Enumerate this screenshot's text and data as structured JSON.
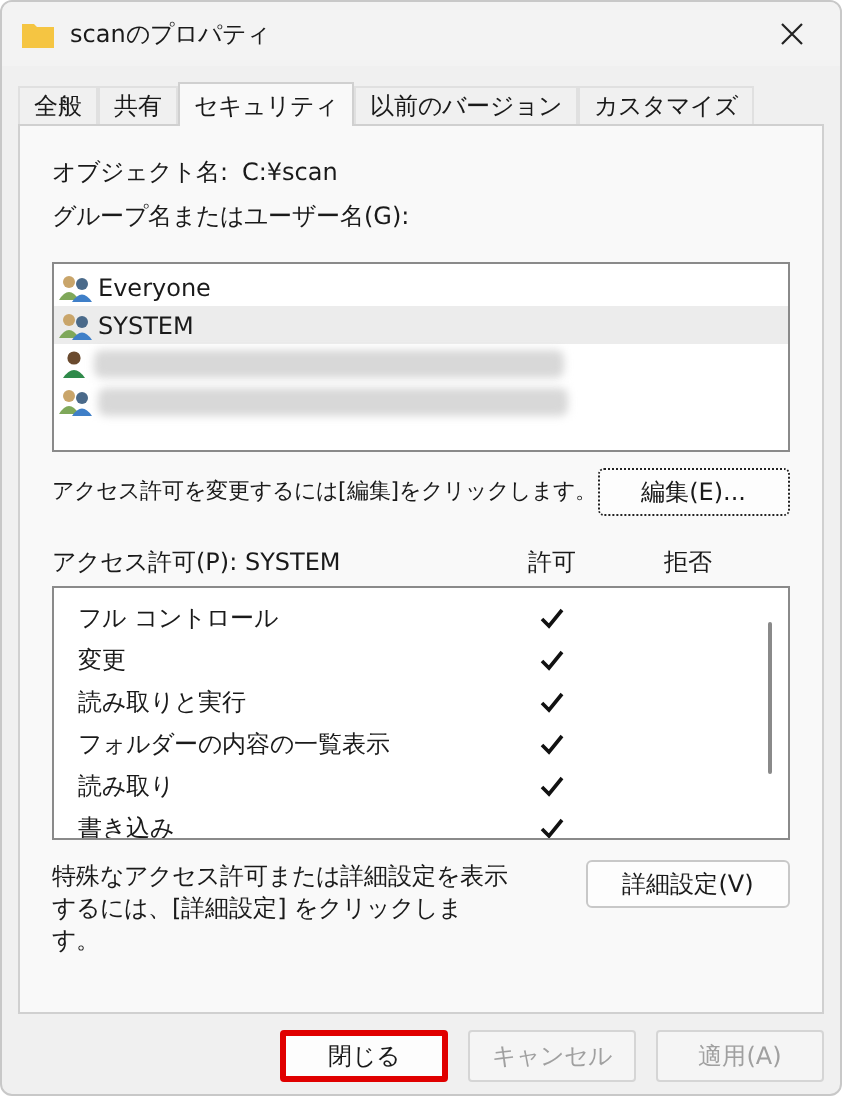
{
  "window": {
    "title": "scanのプロパティ"
  },
  "tabs": [
    {
      "label": "全般",
      "selected": false
    },
    {
      "label": "共有",
      "selected": false
    },
    {
      "label": "セキュリティ",
      "selected": true
    },
    {
      "label": "以前のバージョン",
      "selected": false
    },
    {
      "label": "カスタマイズ",
      "selected": false
    }
  ],
  "object": {
    "label": "オブジェクト名:",
    "value": "C:¥scan"
  },
  "users": {
    "label": "グループ名またはユーザー名(G):",
    "items": [
      {
        "kind": "group",
        "name": "Everyone",
        "selected": false,
        "redacted": false
      },
      {
        "kind": "group",
        "name": "SYSTEM",
        "selected": true,
        "redacted": false
      },
      {
        "kind": "user",
        "selected": false,
        "redacted": true
      },
      {
        "kind": "group",
        "selected": false,
        "redacted": true
      }
    ]
  },
  "edit_hint": "アクセス許可を変更するには[編集]をクリックします。",
  "edit_button": "編集(E)...",
  "permissions": {
    "label": "アクセス許可(P): SYSTEM",
    "allow_header": "許可",
    "deny_header": "拒否",
    "items": [
      {
        "name": "フル コントロール",
        "allow": true,
        "deny": false
      },
      {
        "name": "変更",
        "allow": true,
        "deny": false
      },
      {
        "name": "読み取りと実行",
        "allow": true,
        "deny": false
      },
      {
        "name": "フォルダーの内容の一覧表示",
        "allow": true,
        "deny": false
      },
      {
        "name": "読み取り",
        "allow": true,
        "deny": false
      },
      {
        "name": "書き込み",
        "allow": true,
        "deny": false
      }
    ]
  },
  "advanced_hint": "特殊なアクセス許可または詳細設定を表示するには、[詳細設定] をクリックします。",
  "advanced_button": "詳細設定(V)",
  "buttons": [
    {
      "label": "閉じる",
      "disabled": false,
      "highlighted": true
    },
    {
      "label": "キャンセル",
      "disabled": true,
      "highlighted": false
    },
    {
      "label": "適用(A)",
      "disabled": true,
      "highlighted": false
    }
  ]
}
